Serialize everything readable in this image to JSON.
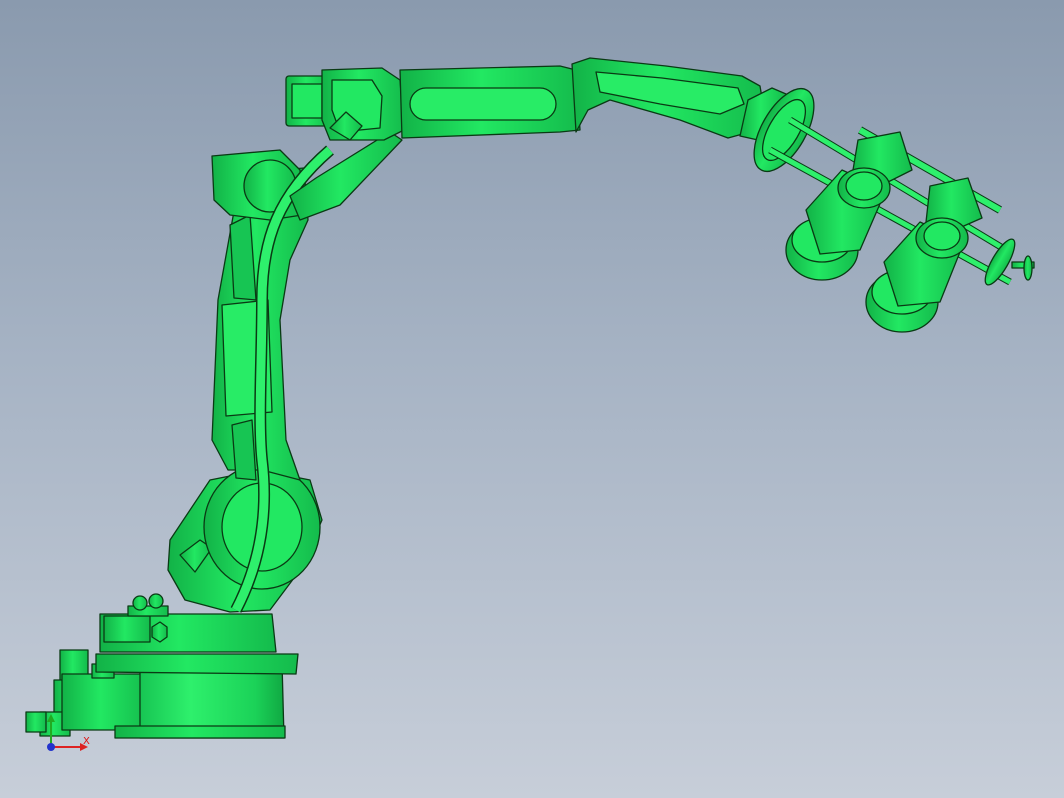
{
  "viewport": {
    "background_top": "#8a9aae",
    "background_bottom": "#c7ced9"
  },
  "model": {
    "fill_color": "#1fe05c",
    "edge_color": "#0a3a14",
    "shade_color": "#12b247"
  },
  "triad": {
    "x_label": "X",
    "x_color": "#dd2222",
    "y_color": "#22aa22",
    "z_color": "#2233cc"
  }
}
